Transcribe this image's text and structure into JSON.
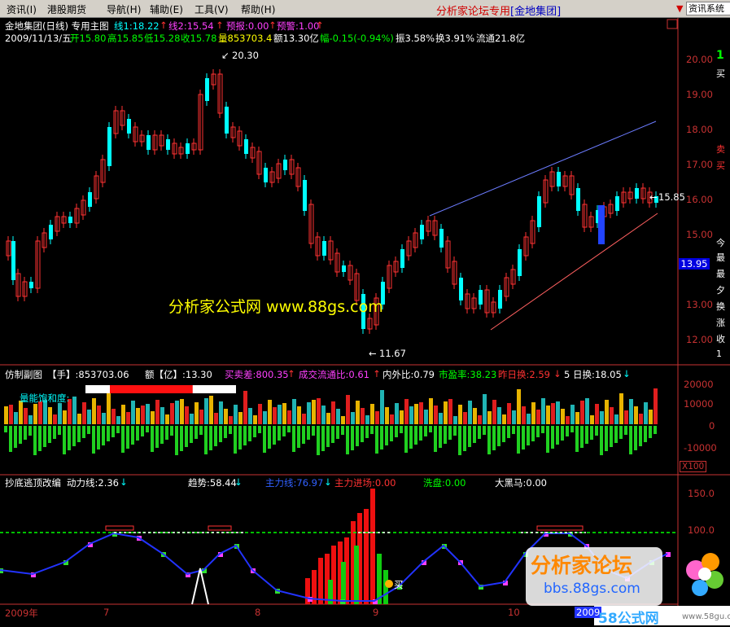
{
  "menu": {
    "items": [
      "资讯(I)",
      "港股期货",
      "导航(H)",
      "辅助(E)",
      "工具(V)",
      "帮助(H)"
    ],
    "brand_prefix": "分析家论坛专用",
    "brand_link": "[金地集团]",
    "right_control": "资讯系统"
  },
  "main": {
    "title_name": "金地集团(日线)",
    "title_main": "专用主图",
    "line1": "线1:18.22",
    "line2": "线2:15.54",
    "forecast": "预报:0.00",
    "warning": "预警:1.00",
    "date": "2009/11/13/五",
    "open": "开15.80",
    "high": "高15.85",
    "low": "低15.28",
    "close": "收15.78",
    "volume": "量853703.4",
    "amount": "额13.30亿",
    "change": "幅-0.15(-0.94%)",
    "amplitude": "振3.58%",
    "turnover": "换3.91%",
    "float": "流通21.8亿",
    "peak_label": "20.30",
    "trough_label": "11.67",
    "last_price_label": "15.85",
    "price_marker": "13.95",
    "watermark": "分析家公式网 www.88gs.com",
    "y_ticks": [
      "20.00",
      "19.00",
      "18.00",
      "17.00",
      "16.00",
      "15.00",
      "14.00",
      "13.00",
      "12.00"
    ],
    "right_partial": [
      "1",
      "买",
      "卖",
      "买",
      "今",
      "最",
      "最",
      "夕",
      "换",
      "涨",
      "收",
      "1"
    ]
  },
  "volume_pane": {
    "name": "仿制副图",
    "hand": "【手】:853703.06",
    "amount": "额【亿】:13.30",
    "buy_sell_diff": "买卖差:800.35",
    "turnover_ratio": "成交流通比:0.61",
    "in_out_ratio": "内外比:0.79",
    "pe": "市盈率:38.23",
    "yesterday_turnover": "昨日换:2.59",
    "five_day": "5 日换:18.05",
    "saturation_label": "量能饱和度:",
    "saturation_level": 0.55,
    "y_ticks": [
      "20000",
      "10000",
      "0",
      "-10000"
    ],
    "scale_note": "X100"
  },
  "indicator_pane": {
    "name": "抄底逃顶改编",
    "power_line": "动力线:2.36",
    "trend": "趋势:58.44",
    "main_force_line": "主力线:76.97",
    "main_force_entry": "主力进场:0.00",
    "washout": "洗盘:0.00",
    "dark_horse": "大黑马:0.00",
    "buy_tag": "买",
    "y_ticks": [
      "150.0",
      "100.0"
    ],
    "x_labels": [
      "2009年",
      "7",
      "8",
      "9",
      "10",
      "2009"
    ]
  },
  "watermark2": {
    "title": "分析家论坛",
    "url": "bbs.88gs.com",
    "footer": "58公式网",
    "footer_url": "www.58gu.com"
  },
  "colors": {
    "up": "#ff3232",
    "down": "#00ffff",
    "axis": "#c83232",
    "grid": "#800000",
    "resistance_line": "#6c7cff",
    "support_line": "#ff6060",
    "dashed_100": "#00ff00"
  }
}
